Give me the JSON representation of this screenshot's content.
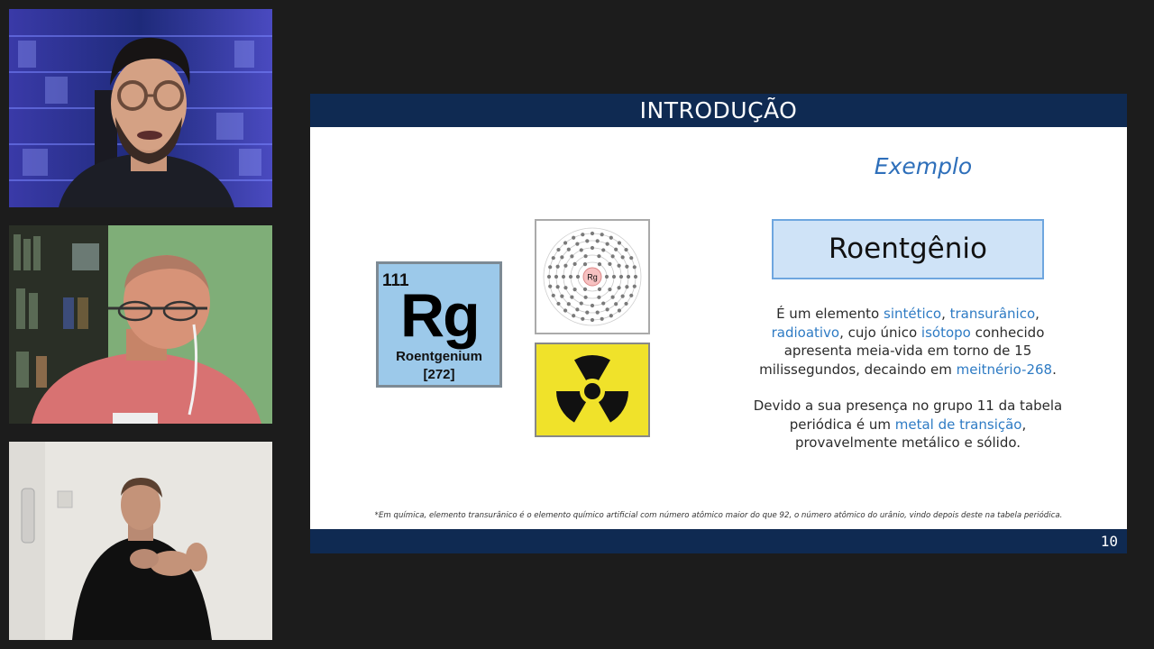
{
  "slide": {
    "header_title": "INTRODUÇÃO",
    "page_number": "10",
    "element_tile": {
      "atomic_number": "111",
      "symbol": "Rg",
      "name": "Roentgenium",
      "mass": "[272]"
    },
    "atom_diagram_label": "Rg",
    "example_title": "Exemplo",
    "element_name": "Roentgênio",
    "paragraph1": {
      "t1": "É um elemento ",
      "k1": "sintético",
      "t2": ", ",
      "k2": "transurânico",
      "t3": ", ",
      "k3": "radioativo",
      "t4": ", cujo único ",
      "k4": "isótopo",
      "t5": " conhecido apresenta meia-vida em torno de 15 milissegundos, decaindo em ",
      "k5": "meitnério-268",
      "t6": "."
    },
    "paragraph2": {
      "t1": "Devido a sua presença no grupo 11 da tabela periódica é um ",
      "k1": "metal de transição",
      "t2": ", provavelmente metálico e sólido."
    },
    "footnote": "*Em química, elemento transurânico é o elemento químico artificial com número atômico maior do que 92, o número atômico do urânio, vindo depois deste na tabela periódica."
  },
  "colors": {
    "header_bar": "#0f2a52",
    "highlight": "#2e7bc4",
    "example_title": "#2e6fba",
    "name_box_fill": "#cfe3f7",
    "hazard_yellow": "#f0e22a"
  },
  "participants": [
    {
      "icon": "participant-video-1"
    },
    {
      "icon": "participant-video-2"
    },
    {
      "icon": "participant-video-3-sign-language-interpreter"
    }
  ]
}
